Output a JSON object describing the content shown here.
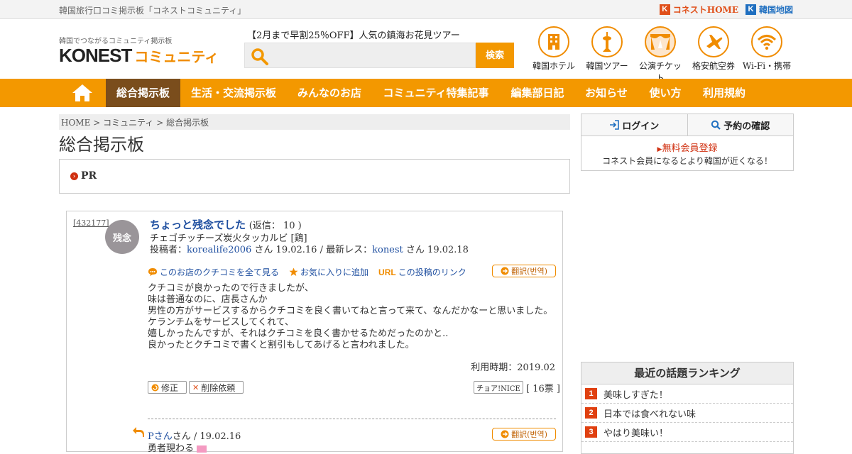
{
  "topbar": {
    "tagline": "韓国旅行口コミ掲示板「コネストコミュニティ」",
    "links": [
      {
        "label": "コネストHOME",
        "icon": "konest-k-icon",
        "color": "#e0501a"
      },
      {
        "label": "韓国地図",
        "icon": "konest-map-k-icon",
        "color": "#1f6fc0"
      }
    ]
  },
  "header": {
    "logo_sub": "韓国でつながるコミュニティ掲示板",
    "logo_main": "KONEST",
    "logo_comm": "コミュニティ",
    "promo": "【2月まで早割25％OFF】人気の鎮海お花見ツアー",
    "search_placeholder": "",
    "search_button": "検索",
    "services": [
      {
        "label": "韓国ホテル",
        "icon": "hotel-icon"
      },
      {
        "label": "韓国ツアー",
        "icon": "tower-icon"
      },
      {
        "label": "公演チケット",
        "icon": "stage-icon"
      },
      {
        "label": "格安航空券",
        "icon": "airplane-icon"
      },
      {
        "label": "Wi-Fi・携帯",
        "icon": "wifi-icon"
      }
    ]
  },
  "nav": {
    "items": [
      {
        "label": "総合掲示板",
        "active": true
      },
      {
        "label": "生活・交流掲示板"
      },
      {
        "label": "みんなのお店"
      },
      {
        "label": "コミュニティ特集記事"
      },
      {
        "label": "編集部日記"
      },
      {
        "label": "お知らせ"
      },
      {
        "label": "使い方"
      },
      {
        "label": "利用規約"
      }
    ]
  },
  "breadcrumb": {
    "home": "HOME",
    "sep": ">",
    "community": "コミュニティ",
    "current": "総合掲示板"
  },
  "page_title": "総合掲示板",
  "pr": {
    "label": "PR"
  },
  "post": {
    "id": "[432177]",
    "avatar_text": "残念",
    "title": "ちょっと残念でした",
    "reply_count": "(返信： 10 )",
    "shop": "チェゴチッチーズ炭火タッカルビ [鶏]",
    "meta_prefix": "投稿者：",
    "author": "korealife2006",
    "author_suffix": " さん 19.02.16 / 最新レス：",
    "last_reply_user": "konest",
    "last_reply_suffix": " さん 19.02.18",
    "link_all_reviews": "このお店のクチコミを全て見る",
    "link_favorite": "お気に入りに追加",
    "link_url_tag": "URL",
    "link_post": "この投稿のリンク",
    "translate": "翻訳(번역)",
    "body": "クチコミが良かったので行きましたが、\n味は普通なのに、店長さんか\n男性の方がサービスするからクチコミを良く書いてねと言って来て、なんだかなーと思いました。\nケランチムをサービスしてくれて、\n嬉しかったんですが、それはクチコミを良く書かせるためだったのかと..\n良かったとクチコミで書くと割引もしてあげると言われました。",
    "period": "利用時期：2019.02",
    "edit_button": "修正",
    "delete_button": "削除依頼",
    "nice_label": "チョア!NICE",
    "votes": "[ 16票 ]",
    "reply_author": "Pさん",
    "reply_meta": "さん / 19.02.16",
    "reply_translate": "翻訳(번역)",
    "reply_text": "勇者現わる"
  },
  "sidebar": {
    "login": "ログイン",
    "reservation": "予約の確認",
    "register": "無料会員登録",
    "register_sub": "コネスト会員になるとより韓国が近くなる！",
    "ranking_title": "最近の話題ランキング",
    "ranking": [
      {
        "rank": "1",
        "title": "美味しすぎた！"
      },
      {
        "rank": "2",
        "title": "日本では食べれない味"
      },
      {
        "rank": "3",
        "title": "やはり美味い！"
      }
    ]
  },
  "colors": {
    "accent": "#f39800",
    "nav_active": "#7a4d1c",
    "link": "#1f4fa0"
  }
}
